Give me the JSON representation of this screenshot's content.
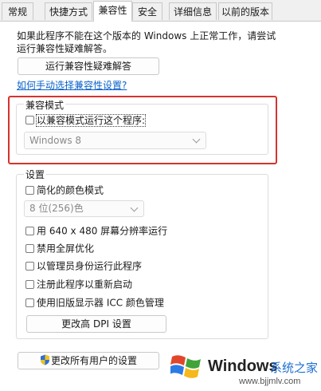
{
  "tabs": [
    {
      "label": "常规",
      "active": false
    },
    {
      "label": "快捷方式",
      "active": false
    },
    {
      "label": "兼容性",
      "active": true
    },
    {
      "label": "安全",
      "active": false
    },
    {
      "label": "详细信息",
      "active": false
    },
    {
      "label": "以前的版本",
      "active": false
    }
  ],
  "intro": {
    "line1": "如果此程序不能在这个版本的 Windows 上正常工作，请尝试",
    "line2": "运行兼容性疑难解答。"
  },
  "troubleshooter_button": "运行兼容性疑难解答",
  "manual_link": "如何手动选择兼容性设置?",
  "compat_mode": {
    "title": "兼容模式",
    "checkbox_label": "以兼容模式运行这个程序:",
    "checked": false,
    "os_selected": "Windows 8"
  },
  "settings": {
    "title": "设置",
    "reduced_color": "简化的颜色模式",
    "color_selected": "8 位(256)色",
    "res_640": "用 640 x 480 屏幕分辨率运行",
    "disable_fullscreen_opt": "禁用全屏优化",
    "run_as_admin": "以管理员身份运行此程序",
    "register_restart": "注册此程序以重新启动",
    "legacy_icc": "使用旧版显示器 ICC 颜色管理",
    "dpi_button": "更改高 DPI 设置"
  },
  "all_users_button": "更改所有用户的设置",
  "watermark": {
    "brand": "Windows",
    "cn": "系统之家",
    "url": "www.bjjmlv.com"
  },
  "colors": {
    "highlight": "#d6332d",
    "link": "#0a62c9"
  }
}
